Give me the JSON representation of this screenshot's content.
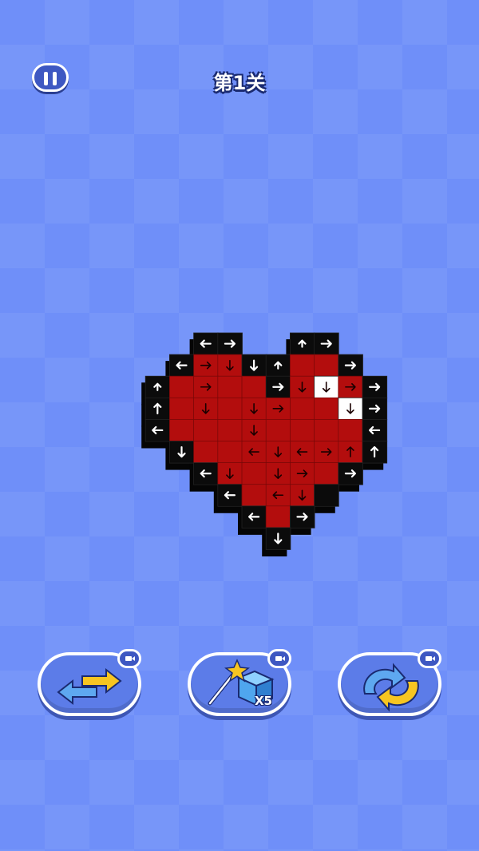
{
  "header": {
    "level_title": "第1关",
    "pause_icon": "pause-icon"
  },
  "puzzle": {
    "name_icon": "pixel-heart",
    "colors": {
      "fill": "#b30d0d",
      "outline": "#0b0b0b",
      "highlight": "#ffffff",
      "arrow_on_red": "#1a0000",
      "arrow_on_black": "#ffffff"
    },
    "rows": [
      [
        {
          "c": 3,
          "t": "k",
          "a": "L"
        },
        {
          "c": 4,
          "t": "k",
          "a": "R"
        },
        {
          "c": 7,
          "t": "k",
          "a": "u"
        },
        {
          "c": 8,
          "t": "k",
          "a": "R"
        }
      ],
      [
        {
          "c": 2,
          "t": "k",
          "a": "L"
        },
        {
          "c": 3,
          "t": "r",
          "a": "R"
        },
        {
          "c": 4,
          "t": "r",
          "a": "D"
        },
        {
          "c": 5,
          "t": "k",
          "a": "D"
        },
        {
          "c": 6,
          "t": "k",
          "a": "u"
        },
        {
          "c": 7,
          "t": "r"
        },
        {
          "c": 8,
          "t": "r"
        },
        {
          "c": 9,
          "t": "k",
          "a": "R"
        }
      ],
      [
        {
          "c": 1,
          "t": "k",
          "a": "u"
        },
        {
          "c": 2,
          "t": "r"
        },
        {
          "c": 3,
          "t": "r",
          "a": "R"
        },
        {
          "c": 4,
          "t": "r"
        },
        {
          "c": 5,
          "t": "r"
        },
        {
          "c": 6,
          "t": "k",
          "a": "R"
        },
        {
          "c": 7,
          "t": "r",
          "a": "D"
        },
        {
          "c": 8,
          "t": "w",
          "a": "D"
        },
        {
          "c": 9,
          "t": "r",
          "a": "R"
        },
        {
          "c": 10,
          "t": "k",
          "a": "R"
        }
      ],
      [
        {
          "c": 1,
          "t": "k",
          "a": "U"
        },
        {
          "c": 2,
          "t": "r"
        },
        {
          "c": 3,
          "t": "r",
          "a": "D"
        },
        {
          "c": 4,
          "t": "r"
        },
        {
          "c": 5,
          "t": "r",
          "a": "D"
        },
        {
          "c": 6,
          "t": "r",
          "a": "R"
        },
        {
          "c": 7,
          "t": "r"
        },
        {
          "c": 8,
          "t": "r"
        },
        {
          "c": 9,
          "t": "w",
          "a": "D"
        },
        {
          "c": 10,
          "t": "k",
          "a": "R"
        }
      ],
      [
        {
          "c": 1,
          "t": "k",
          "a": "L"
        },
        {
          "c": 2,
          "t": "r"
        },
        {
          "c": 3,
          "t": "r"
        },
        {
          "c": 4,
          "t": "r"
        },
        {
          "c": 5,
          "t": "r",
          "a": "D"
        },
        {
          "c": 6,
          "t": "r"
        },
        {
          "c": 7,
          "t": "r"
        },
        {
          "c": 8,
          "t": "r"
        },
        {
          "c": 9,
          "t": "r"
        },
        {
          "c": 10,
          "t": "k",
          "a": "L"
        }
      ],
      [
        {
          "c": 2,
          "t": "k",
          "a": "D"
        },
        {
          "c": 3,
          "t": "r"
        },
        {
          "c": 4,
          "t": "r"
        },
        {
          "c": 5,
          "t": "r",
          "a": "L"
        },
        {
          "c": 6,
          "t": "r",
          "a": "D"
        },
        {
          "c": 7,
          "t": "r",
          "a": "L"
        },
        {
          "c": 8,
          "t": "r",
          "a": "R"
        },
        {
          "c": 9,
          "t": "r",
          "a": "U"
        },
        {
          "c": 10,
          "t": "k",
          "a": "U"
        }
      ],
      [
        {
          "c": 3,
          "t": "k",
          "a": "L"
        },
        {
          "c": 4,
          "t": "r",
          "a": "D"
        },
        {
          "c": 5,
          "t": "r"
        },
        {
          "c": 6,
          "t": "r",
          "a": "D"
        },
        {
          "c": 7,
          "t": "r",
          "a": "R"
        },
        {
          "c": 8,
          "t": "r"
        },
        {
          "c": 9,
          "t": "k",
          "a": "R"
        }
      ],
      [
        {
          "c": 4,
          "t": "k",
          "a": "L"
        },
        {
          "c": 5,
          "t": "r"
        },
        {
          "c": 6,
          "t": "r",
          "a": "L"
        },
        {
          "c": 7,
          "t": "r",
          "a": "D"
        },
        {
          "c": 8,
          "t": "k"
        }
      ],
      [
        {
          "c": 5,
          "t": "k",
          "a": "L"
        },
        {
          "c": 6,
          "t": "r"
        },
        {
          "c": 7,
          "t": "k",
          "a": "R"
        }
      ],
      [
        {
          "c": 6,
          "t": "k",
          "a": "D"
        }
      ]
    ]
  },
  "tools": [
    {
      "name": "swap",
      "icon": "swap-arrows-icon",
      "ad_icon": "video-ad-icon"
    },
    {
      "name": "magic",
      "icon": "magic-wand-cube-icon",
      "ad_icon": "video-ad-icon",
      "count": "X5"
    },
    {
      "name": "rotate",
      "icon": "rotate-arrows-icon",
      "ad_icon": "video-ad-icon"
    }
  ]
}
